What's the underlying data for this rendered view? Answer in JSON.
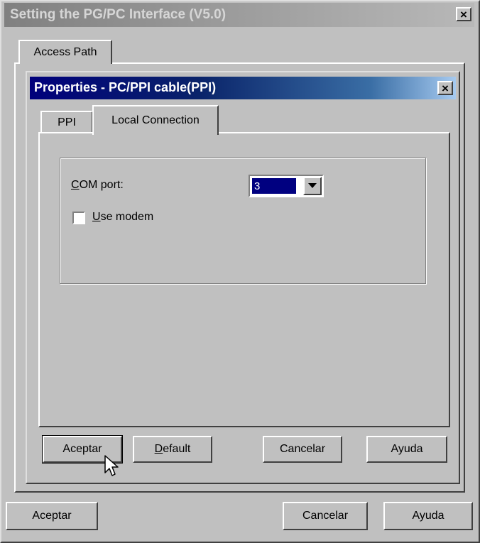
{
  "outer_window": {
    "title": "Setting the PG/PC Interface (V5.0)",
    "close_label": "×",
    "tabs": [
      {
        "label": "Access Path",
        "active": true
      }
    ],
    "buttons": {
      "ok": "Aceptar",
      "cancel": "Cancelar",
      "help": "Ayuda"
    }
  },
  "inner_dialog": {
    "title": "Properties - PC/PPI cable(PPI)",
    "close_label": "×",
    "tabs": [
      {
        "label": "PPI",
        "active": false
      },
      {
        "label": "Local Connection",
        "active": true
      }
    ],
    "com_port": {
      "label_accel": "C",
      "label_rest": "OM port:",
      "value": "3"
    },
    "use_modem": {
      "label_accel": "U",
      "label_rest": "se modem",
      "checked": false
    },
    "buttons": {
      "ok": "Aceptar",
      "default_accel": "D",
      "default_rest": "efault",
      "cancel": "Cancelar",
      "help": "Ayuda"
    }
  },
  "colors": {
    "face": "#c0c0c0",
    "active_title": "#0a246a",
    "inactive_title": "#808080",
    "selection": "#000080"
  },
  "icons": [
    "close-icon",
    "dropdown-arrow-icon",
    "mouse-pointer-icon"
  ]
}
